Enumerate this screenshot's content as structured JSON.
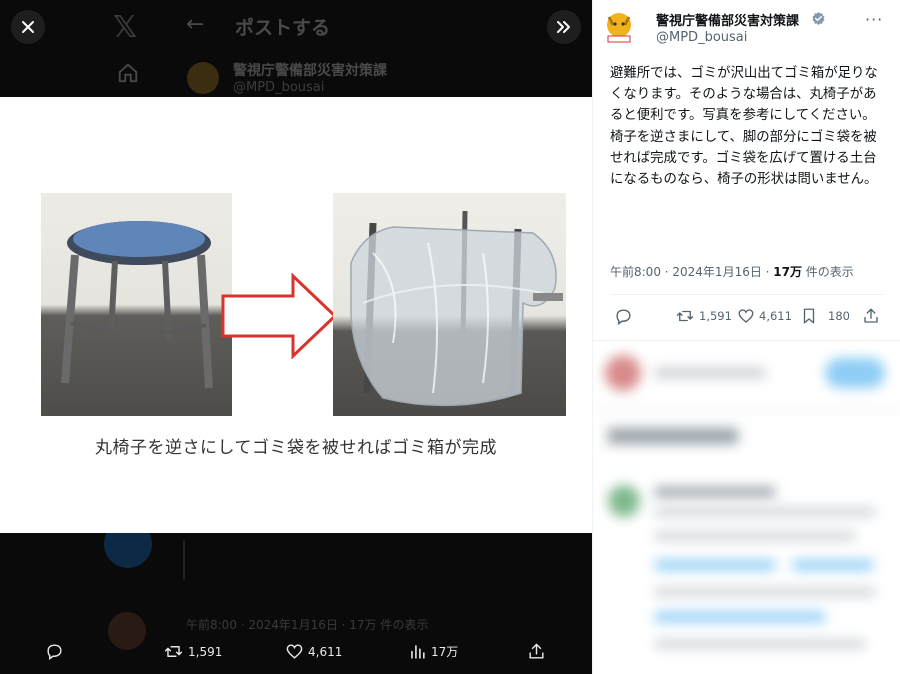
{
  "viewer": {
    "background_post": {
      "title": "ポストする",
      "account_name": "警視庁警備部災害対策課",
      "handle": "@MPD_bousai",
      "meta": "午前8:00 · 2024年1月16日 · 17万 件の表示"
    },
    "media": {
      "caption": "丸椅子を逆さにしてゴミ袋を被せればゴミ箱が完成"
    },
    "actions": {
      "retweets": "1,591",
      "likes": "4,611",
      "views": "17万"
    }
  },
  "post": {
    "display_name": "警視庁警備部災害対策課",
    "handle": "@MPD_bousai",
    "text": "避難所では、ゴミが沢山出てゴミ箱が足りなくなります。そのような場合は、丸椅子があると便利です。写真を参考にしてください。椅子を逆さまにして、脚の部分にゴミ袋を被せれば完成です。ゴミ袋を広げて置ける土台になるものなら、椅子の形状は問いません。",
    "time": "午前8:00 · 2024年1月16日 · ",
    "views_count": "17万",
    "views_label": " 件の表示",
    "retweets": "1,591",
    "likes": "4,611",
    "bookmarks": "180",
    "colors": {
      "accent": "#1d9bf0",
      "verified": "#829aab"
    }
  }
}
